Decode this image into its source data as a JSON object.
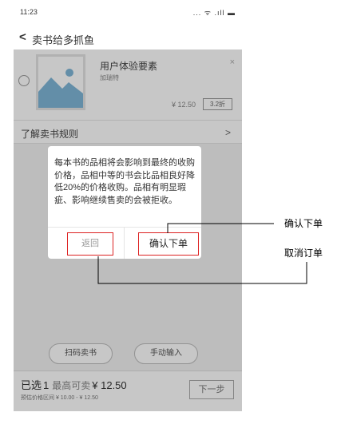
{
  "status_bar": {
    "time": "11:23",
    "icons": "... ᯤ .ıll ▬"
  },
  "nav": {
    "back_glyph": "<",
    "title": "卖书给多抓鱼"
  },
  "book": {
    "title": "用户体验要素",
    "author": "加瑞特",
    "remove_glyph": "×",
    "price": "¥ 12.50",
    "discount": "3.2折"
  },
  "rules": {
    "label": "了解卖书规则",
    "arrow": ">"
  },
  "modal": {
    "message": "每本书的品相将会影响到最终的收购价格，品相中等的书会比品相良好降低20%的价格收购。品相有明显瑕疵、影响继续售卖的会被拒收。",
    "back_label": "返回",
    "confirm_label": "确认下单"
  },
  "actions": {
    "scan_label": "扫码卖书",
    "manual_label": "手动输入"
  },
  "bottom_bar": {
    "selected_label": "已选",
    "selected_count": "1",
    "max_label": "最高可卖",
    "max_value": "¥ 12.50",
    "range_text": "预估价格区间 ¥ 10.00 - ¥ 12.50",
    "next_label": "下一步"
  },
  "annotations": {
    "confirm_note": "确认下单",
    "cancel_note": "取消订单"
  },
  "colors": {
    "highlight": "#dd2222",
    "overlay": "#000000"
  }
}
